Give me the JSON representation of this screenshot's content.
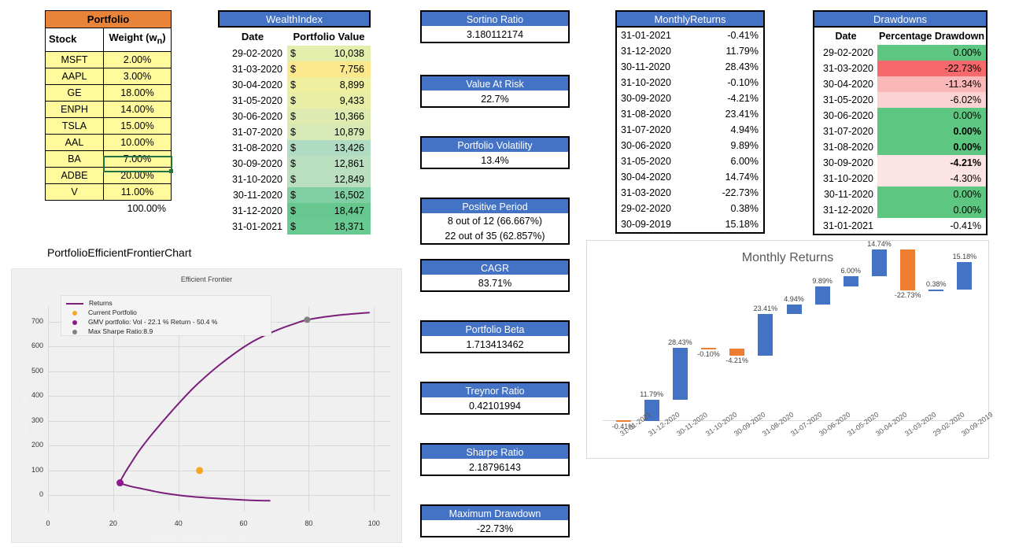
{
  "portfolio": {
    "title": "Portfolio",
    "columns": [
      "Stock",
      "Weight (w",
      "n",
      ")"
    ],
    "col_stock": "Stock",
    "col_weight_pre": "Weight (w",
    "col_weight_sub": "n",
    "col_weight_post": ")",
    "rows": [
      {
        "stock": "MSFT",
        "weight": "2.00%"
      },
      {
        "stock": "AAPL",
        "weight": "3.00%"
      },
      {
        "stock": "GE",
        "weight": "18.00%"
      },
      {
        "stock": "ENPH",
        "weight": "14.00%"
      },
      {
        "stock": "TSLA",
        "weight": "15.00%"
      },
      {
        "stock": "AAL",
        "weight": "10.00%"
      },
      {
        "stock": "BA",
        "weight": "7.00%"
      },
      {
        "stock": "ADBE",
        "weight": "20.00%"
      },
      {
        "stock": "V",
        "weight": "11.00%"
      }
    ],
    "total": "100.00%",
    "header_color": "#E8833A",
    "cell_color": "#FFFB9D",
    "selected_row": "ADBE"
  },
  "wealthindex": {
    "title": "WealthIndex",
    "col_date": "Date",
    "col_value": "Portfolio Value",
    "currency": "$",
    "rows": [
      {
        "date": "29-02-2020",
        "value": "10,038",
        "fill": "#E4EEAC"
      },
      {
        "date": "31-03-2020",
        "value": "7,756",
        "fill": "#FCE88C"
      },
      {
        "date": "30-04-2020",
        "value": "8,899",
        "fill": "#EEEF9F"
      },
      {
        "date": "31-05-2020",
        "value": "9,433",
        "fill": "#E9EEA6"
      },
      {
        "date": "30-06-2020",
        "value": "10,366",
        "fill": "#DDEBB0"
      },
      {
        "date": "31-07-2020",
        "value": "10,879",
        "fill": "#D7E9B5"
      },
      {
        "date": "31-08-2020",
        "value": "13,426",
        "fill": "#AFDCC2"
      },
      {
        "date": "30-09-2020",
        "value": "12,861",
        "fill": "#B9DFBF"
      },
      {
        "date": "31-10-2020",
        "value": "12,849",
        "fill": "#B9DFBF"
      },
      {
        "date": "30-11-2020",
        "value": "16,502",
        "fill": "#7FCFA2"
      },
      {
        "date": "31-12-2020",
        "value": "18,447",
        "fill": "#66C88F"
      },
      {
        "date": "31-01-2021",
        "value": "18,371",
        "fill": "#68C991"
      }
    ]
  },
  "metrics": [
    {
      "label": "Sortino Ratio",
      "value": "3.180112174"
    },
    {
      "label": "Value At Risk",
      "value": "22.7%"
    },
    {
      "label": "Portfolio Volatility",
      "value": "13.4%"
    },
    {
      "label": "Positive Period",
      "value": "8 out of 12 (66.667%)",
      "value2": "22 out of 35 (62.857%)"
    },
    {
      "label": "CAGR",
      "value": "83.71%"
    },
    {
      "label": "Portfolio Beta",
      "value": "1.713413462"
    },
    {
      "label": "Treynor Ratio",
      "value": "0.42101994"
    },
    {
      "label": "Sharpe Ratio",
      "value": "2.18796143"
    },
    {
      "label": "Maximum Drawdown",
      "value": "-22.73%"
    }
  ],
  "monthlyreturns": {
    "title": "MonthlyReturns",
    "rows": [
      {
        "date": "31-01-2021",
        "value": "-0.41%"
      },
      {
        "date": "31-12-2020",
        "value": "11.79%"
      },
      {
        "date": "30-11-2020",
        "value": "28.43%"
      },
      {
        "date": "31-10-2020",
        "value": "-0.10%"
      },
      {
        "date": "30-09-2020",
        "value": "-4.21%"
      },
      {
        "date": "31-08-2020",
        "value": "23.41%"
      },
      {
        "date": "31-07-2020",
        "value": "4.94%"
      },
      {
        "date": "30-06-2020",
        "value": "9.89%"
      },
      {
        "date": "31-05-2020",
        "value": "6.00%"
      },
      {
        "date": "30-04-2020",
        "value": "14.74%"
      },
      {
        "date": "31-03-2020",
        "value": "-22.73%"
      },
      {
        "date": "29-02-2020",
        "value": "0.38%"
      },
      {
        "date": "30-09-2019",
        "value": "15.18%"
      }
    ]
  },
  "drawdowns": {
    "title": "Drawdowns",
    "col_date": "Date",
    "col_value": "Percentage Drawdown",
    "rows": [
      {
        "date": "29-02-2020",
        "value": "0.00%",
        "fill": "g-dark",
        "bold": false
      },
      {
        "date": "31-03-2020",
        "value": "-22.73%",
        "fill": "r-dark",
        "bold": false
      },
      {
        "date": "30-04-2020",
        "value": "-11.34%",
        "fill": "r-mid",
        "bold": false
      },
      {
        "date": "31-05-2020",
        "value": "-6.02%",
        "fill": "r-lite",
        "bold": false
      },
      {
        "date": "30-06-2020",
        "value": "0.00%",
        "fill": "g-dark",
        "bold": false
      },
      {
        "date": "31-07-2020",
        "value": "0.00%",
        "fill": "g-dark",
        "bold": true
      },
      {
        "date": "31-08-2020",
        "value": "0.00%",
        "fill": "g-dark",
        "bold": true
      },
      {
        "date": "30-09-2020",
        "value": "-4.21%",
        "fill": "r-pale",
        "bold": true
      },
      {
        "date": "31-10-2020",
        "value": "-4.30%",
        "fill": "r-pale",
        "bold": false
      },
      {
        "date": "30-11-2020",
        "value": "0.00%",
        "fill": "g-dark",
        "bold": false
      },
      {
        "date": "31-12-2020",
        "value": "0.00%",
        "fill": "g-dark",
        "bold": false
      },
      {
        "date": "31-01-2021",
        "value": "-0.41%",
        "fill": "nofill",
        "bold": false
      }
    ]
  },
  "efchart": {
    "caption": "PortfolioEfficientFrontierChart",
    "legend": [
      {
        "type": "line",
        "label": "Returns",
        "color": "#7B1F7B"
      },
      {
        "type": "dot",
        "label": "Current Portfolio",
        "color": "#F5A623"
      },
      {
        "type": "dot",
        "label": "GMV portfolio: Vol - 22.1 % Return - 50.4 %",
        "color": "#8E1B8E"
      },
      {
        "type": "dot",
        "label": "Max Sharpe Ratio:8.9",
        "color": "#808080"
      }
    ]
  },
  "chart_data": [
    {
      "type": "line",
      "title": "Efficient Frontier",
      "xlabel": "Annualised portfolio volatility (in %)",
      "ylabel": "Annualised returns (in %)",
      "xlim": [
        0,
        105
      ],
      "ylim": [
        -40,
        760
      ],
      "xticks": [
        0,
        20,
        40,
        60,
        80,
        100
      ],
      "yticks": [
        0,
        100,
        200,
        300,
        400,
        500,
        600,
        700
      ],
      "grid": true,
      "legend_position": "upper-left",
      "series": [
        {
          "name": "Returns",
          "color": "#7B1F7B",
          "points": [
            [
              68.0,
              -22
            ],
            [
              62.0,
              -20
            ],
            [
              56.0,
              -16
            ],
            [
              50.0,
              -11
            ],
            [
              44.0,
              -5
            ],
            [
              38.0,
              4
            ],
            [
              33.0,
              15
            ],
            [
              29.0,
              26
            ],
            [
              26.0,
              34
            ],
            [
              24.0,
              41
            ],
            [
              22.8,
              46
            ],
            [
              22.1,
              50.4
            ],
            [
              22.2,
              58
            ],
            [
              22.8,
              72
            ],
            [
              23.8,
              95
            ],
            [
              25.5,
              130
            ],
            [
              28.0,
              180
            ],
            [
              32.0,
              248
            ],
            [
              38.0,
              340
            ],
            [
              45.0,
              438
            ],
            [
              53.0,
              530
            ],
            [
              62.0,
              614
            ],
            [
              70.0,
              665
            ],
            [
              76.0,
              694
            ],
            [
              79.5,
              708
            ],
            [
              84.0,
              718
            ],
            [
              90.0,
              728
            ],
            [
              98.5,
              737
            ]
          ]
        }
      ],
      "markers": [
        {
          "name": "Current Portfolio",
          "x": 46.5,
          "y": 100,
          "color": "#F5A623"
        },
        {
          "name": "GMV portfolio",
          "x": 22.1,
          "y": 50.4,
          "color": "#8E1B8E"
        },
        {
          "name": "Max Sharpe Ratio",
          "x": 79.5,
          "y": 708,
          "color": "#808080"
        }
      ]
    },
    {
      "type": "bar",
      "subtype": "waterfall",
      "title": "Monthly Returns",
      "xlabel": "",
      "ylabel": "",
      "grid": false,
      "categories": [
        "31-01-2021",
        "31-12-2020",
        "30-11-2020",
        "31-10-2020",
        "30-09-2020",
        "31-08-2020",
        "31-07-2020",
        "30-06-2020",
        "31-05-2020",
        "30-04-2020",
        "31-03-2020",
        "29-02-2020",
        "30-09-2019"
      ],
      "values": [
        -0.41,
        11.79,
        28.43,
        -0.1,
        -4.21,
        23.41,
        4.94,
        9.89,
        6.0,
        14.74,
        -22.73,
        0.38,
        15.18
      ],
      "labels": [
        "-0.41%",
        "11.79%",
        "28.43%",
        "-0.10%",
        "-4.21%",
        "23.41%",
        "4.94%",
        "9.89%",
        "6.00%",
        "14.74%",
        "-22.73%",
        "0.38%",
        "15.18%"
      ],
      "cumulative_start": [
        0,
        -0.41,
        11.38,
        39.81,
        39.71,
        35.5,
        58.91,
        63.85,
        73.74,
        79.74,
        94.48,
        71.75,
        72.13
      ],
      "positive_color": "#4472C4",
      "negative_color": "#ED7D31"
    }
  ]
}
